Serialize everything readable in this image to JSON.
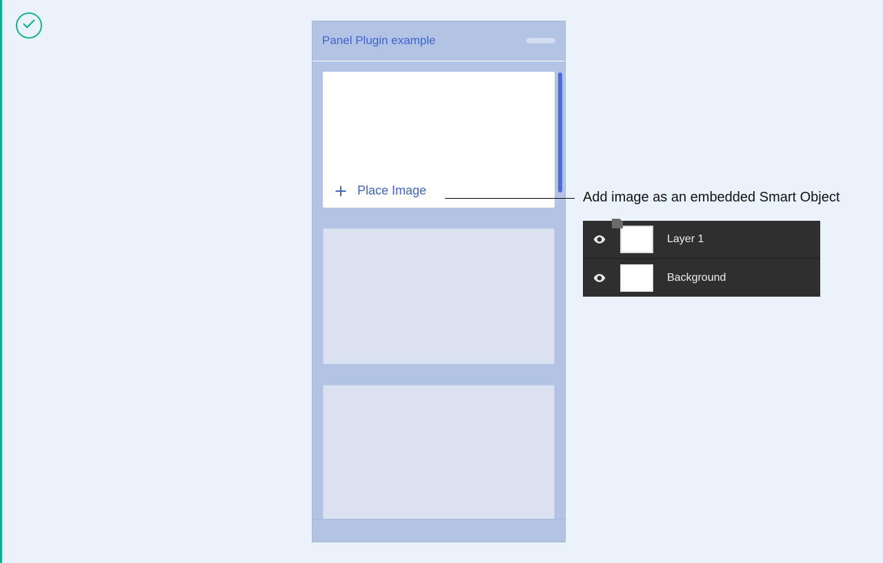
{
  "panel": {
    "title": "Panel Plugin example",
    "place_image_label": "Place Image"
  },
  "annotation": {
    "text": "Add image as an embedded Smart Object"
  },
  "layers": {
    "items": [
      {
        "name": "Layer 1",
        "type": "smart-object"
      },
      {
        "name": "Background",
        "type": "plain"
      }
    ]
  }
}
